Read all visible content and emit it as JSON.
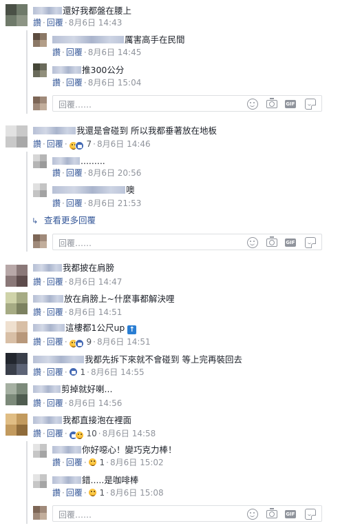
{
  "labels": {
    "like": "讚",
    "reply": "回覆",
    "reply_placeholder": "回覆……",
    "view_more": "查看更多回覆",
    "gif": "GIF"
  },
  "comments": [
    {
      "id": "c1",
      "text": "還好我都盤在腰上",
      "date": "8月6日 14:43"
    },
    {
      "id": "r1a",
      "text": "厲害高手在民間",
      "date": "8月6日 14:45"
    },
    {
      "id": "r1b",
      "text": "推300公分",
      "date": "8月6日 15:04"
    },
    {
      "id": "c2",
      "text": "我還是會碰到 所以我都垂著放在地板",
      "date": "8月6日 14:46",
      "reactions": "7"
    },
    {
      "id": "r2a",
      "text": ".........",
      "date": "8月6日 20:56"
    },
    {
      "id": "r2b",
      "text": "噢",
      "date": "8月6日 21:53"
    },
    {
      "id": "c3",
      "text": "我都披在肩膀",
      "date": "8月6日 14:47"
    },
    {
      "id": "c4",
      "text": "放在肩膀上~什麼事都解決哩",
      "date": "8月6日 14:51"
    },
    {
      "id": "c5",
      "text": "這樓都1公尺up",
      "date": "8月6日 14:51",
      "reactions": "9"
    },
    {
      "id": "c6",
      "text": "我都先拆下來就不會碰到 等上完再裝回去",
      "date": "8月6日 14:55",
      "reactions": "1"
    },
    {
      "id": "c7",
      "text": "剪掉就好喇...",
      "date": "8月6日 14:56"
    },
    {
      "id": "c8",
      "text": "我都直接泡在裡面",
      "date": "8月6日 14:58",
      "reactions": "10"
    },
    {
      "id": "r8a",
      "text": "你好噁心！變巧克力棒！",
      "date": "8月6日 15:02",
      "reactions": "1"
    },
    {
      "id": "r8b",
      "text": "錯.....是咖啡棒",
      "date": "8月6日 15:08",
      "reactions": "1"
    }
  ],
  "colors": {
    "link": "#365899",
    "meta": "#90949c",
    "text": "#1d2129",
    "border": "#dddfe2",
    "like_blue": "#4267b2"
  }
}
